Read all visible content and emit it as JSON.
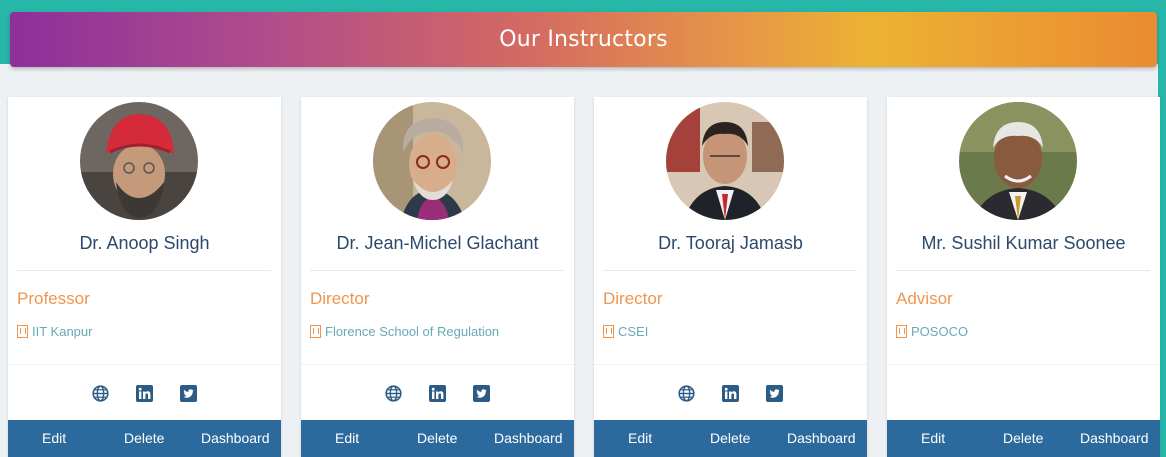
{
  "header": {
    "title": "Our Instructors"
  },
  "colors": {
    "accent_teal": "#27b7a8",
    "footer_blue": "#2c6a9e",
    "role_orange": "#f0954e",
    "org_teal": "#6aa8b8",
    "name_blue": "#2b4a6b"
  },
  "actions": {
    "edit": "Edit",
    "delete": "Delete",
    "dashboard": "Dashboard"
  },
  "instructors": [
    {
      "name": "Dr. Anoop Singh",
      "role": "Professor",
      "org": "IIT Kanpur",
      "social": [
        "globe-icon",
        "linkedin-icon",
        "twitter-icon"
      ]
    },
    {
      "name": "Dr. Jean-Michel Glachant",
      "role": "Director",
      "org": "Florence School of Regulation",
      "social": [
        "globe-icon",
        "linkedin-icon",
        "twitter-icon"
      ]
    },
    {
      "name": "Dr. Tooraj Jamasb",
      "role": "Director",
      "org": "CSEI",
      "social": [
        "globe-icon",
        "linkedin-icon",
        "twitter-icon"
      ]
    },
    {
      "name": "Mr. Sushil Kumar Soonee",
      "role": "Advisor",
      "org": "POSOCO",
      "social": []
    }
  ]
}
